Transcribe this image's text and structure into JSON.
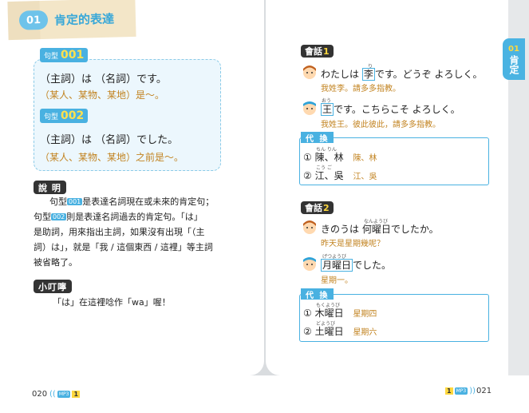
{
  "header": {
    "lesson_num": "01",
    "title": "肯定的表達"
  },
  "side_tab": {
    "num": "01",
    "text": "肯定"
  },
  "patterns": [
    {
      "tag_label": "句型",
      "tag_num": "001",
      "jp": "（主詞）は （名詞）です。",
      "cn": "（某人、某物、某地）是～。"
    },
    {
      "tag_label": "句型",
      "tag_num": "002",
      "jp": "（主詞）は （名詞）でした。",
      "cn": "（某人、某物、某地）之前是～。"
    }
  ],
  "explain": {
    "label": "說 明",
    "l1_pre": "句型",
    "l1_hl": "001",
    "l1_post": "是表達名詞現在或未來的肯定句；",
    "l2_pre": "句型",
    "l2_hl": "002",
    "l2_post": "則是表達名詞過去的肯定句。「は」",
    "l3": "是助詞，用來指出主詞，如果沒有出現「（主",
    "l4": "詞）は」，就是「我 / 這個東西 / 這裡」等主詞",
    "l5": "被省略了。"
  },
  "tip": {
    "label": "小叮嚀",
    "text": "「は」在這裡唸作「wa」喔！"
  },
  "footer": {
    "left_page": "020",
    "right_page": "021",
    "mp3_label": "MP3",
    "mp3_num": "1"
  },
  "conv1": {
    "label": "會話",
    "num": "1",
    "a_pre": "わたしは",
    "a_name": "李",
    "a_name_ruby": "り",
    "a_post": "です。どうぞ よろしく。",
    "a_zh": "我姓李。請多多指教。",
    "b_name": "王",
    "b_name_ruby": "おう",
    "b_post": "です。こちらこそ よろしく。",
    "b_zh": "我姓王。彼此彼此，請多多指教。"
  },
  "sub1": {
    "head": "代 換",
    "rows": [
      {
        "num": "①",
        "jp": "陳、林",
        "ruby": "ちん  りん",
        "zh": "陳、林"
      },
      {
        "num": "②",
        "jp": "江、吳",
        "ruby": "こう  ご",
        "zh": "江、吳"
      }
    ]
  },
  "conv2": {
    "label": "會話",
    "num": "2",
    "a_pre": "きのうは",
    "a_word": "何曜日",
    "a_word_ruby": "なんようび",
    "a_post": "でしたか。",
    "a_zh": "昨天是星期幾呢？",
    "b_word": "月曜日",
    "b_word_ruby": "げつようび",
    "b_post": "でした。",
    "b_zh": "星期一。"
  },
  "sub2": {
    "head": "代 換",
    "rows": [
      {
        "num": "①",
        "jp": "木曜日",
        "ruby": "もくようび",
        "zh": "星期四"
      },
      {
        "num": "②",
        "jp": "土曜日",
        "ruby": "どようび",
        "zh": "星期六"
      }
    ]
  }
}
